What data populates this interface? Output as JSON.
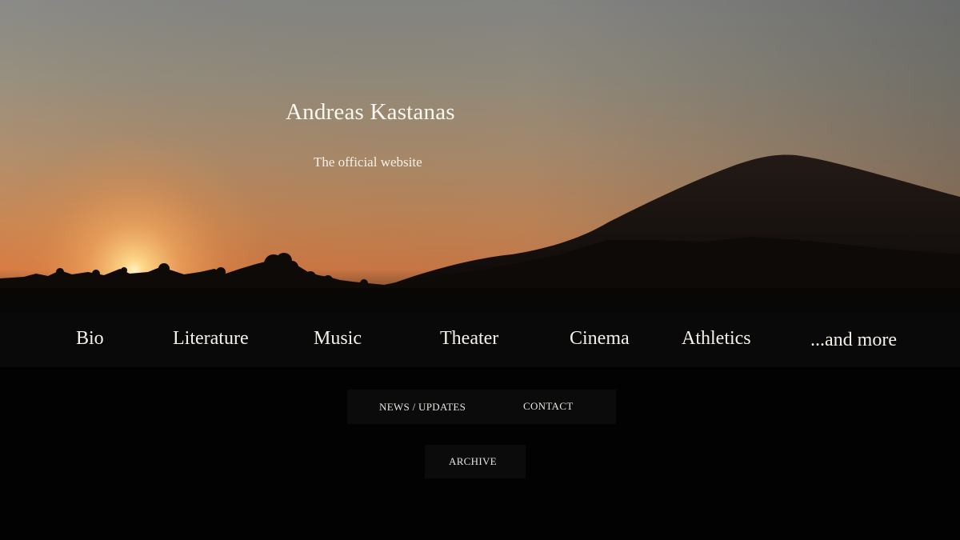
{
  "header": {
    "title": "Andreas Kastanas",
    "tagline": "The official website"
  },
  "main_nav": {
    "items": [
      {
        "label": "Bio"
      },
      {
        "label": "Literature"
      },
      {
        "label": "Music"
      },
      {
        "label": "Theater"
      },
      {
        "label": "Cinema"
      },
      {
        "label": "Athletics"
      },
      {
        "label": "...and more"
      }
    ]
  },
  "secondary_nav": {
    "news": "NEWS / UPDATES",
    "contact": "CONTACT",
    "archive": "ARCHIVE"
  },
  "colors": {
    "page_background": "#020202",
    "nav_background": "#0a0909",
    "text": "#f5f1ea",
    "sunset_glow": "#f6b46e"
  }
}
